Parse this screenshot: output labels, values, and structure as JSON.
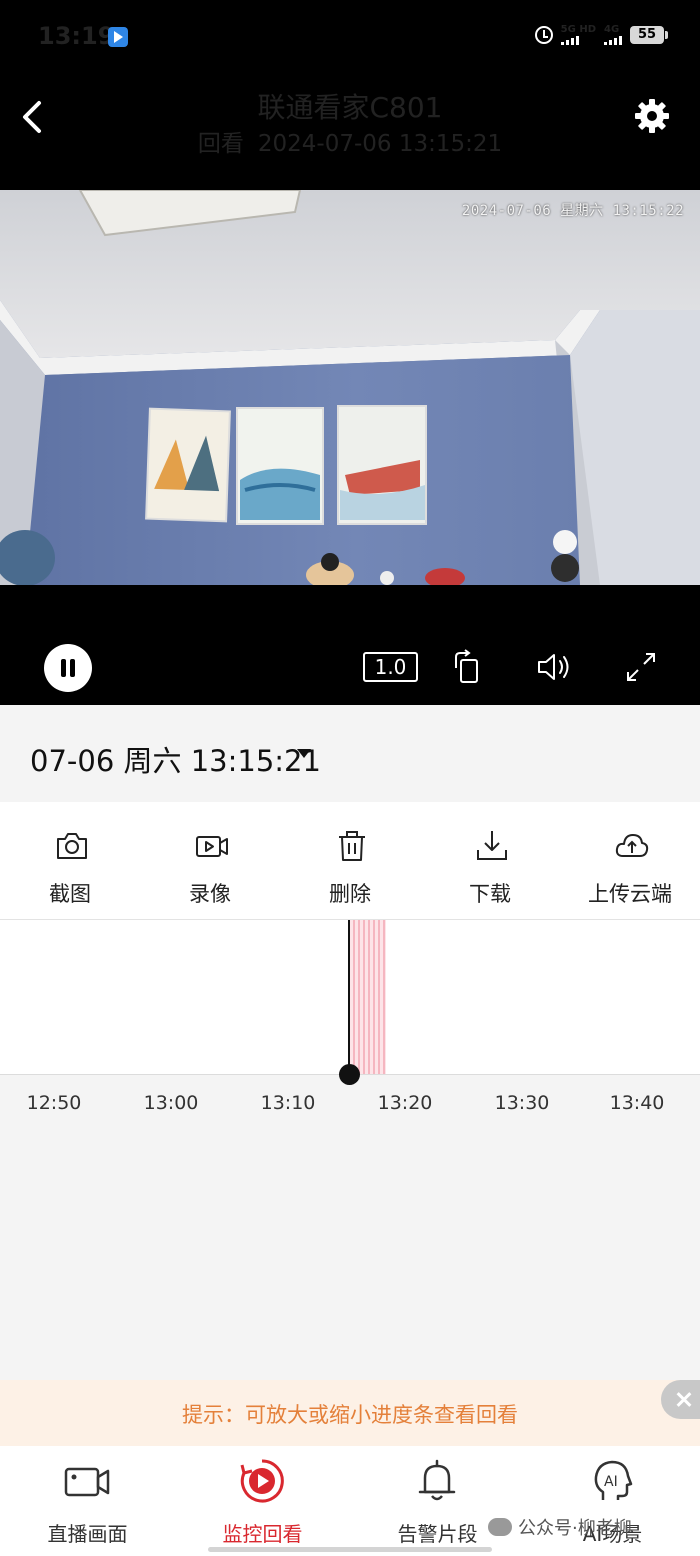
{
  "status_bar": {
    "time": "13:19",
    "network_1": "5G HD",
    "network_2": "4G",
    "battery": "55"
  },
  "header": {
    "title": "联通看家C801",
    "mode_label": "回看",
    "datetime": "2024-07-06 13:15:21"
  },
  "video": {
    "osd_timestamp": "2024-07-06 星期六 13:15:22"
  },
  "controls": {
    "speed": "1.0"
  },
  "date_picker": {
    "value": "07-06 周六 13:15:21"
  },
  "actions": [
    {
      "label": "截图",
      "icon": "camera-icon"
    },
    {
      "label": "录像",
      "icon": "video-record-icon"
    },
    {
      "label": "删除",
      "icon": "trash-icon"
    },
    {
      "label": "下载",
      "icon": "download-icon"
    },
    {
      "label": "上传云端",
      "icon": "cloud-upload-icon"
    }
  ],
  "timeline": {
    "ticks": [
      "12:50",
      "13:00",
      "13:10",
      "13:20",
      "13:30",
      "13:40"
    ],
    "current_time": "13:15:21"
  },
  "hint": {
    "text": "提示：可放大或缩小进度条查看回看"
  },
  "bottom_nav": [
    {
      "label": "直播画面",
      "icon": "live-camera-icon",
      "active": false
    },
    {
      "label": "监控回看",
      "icon": "playback-icon",
      "active": true
    },
    {
      "label": "告警片段",
      "icon": "bell-icon",
      "active": false
    },
    {
      "label": "AI场景",
      "icon": "ai-head-icon",
      "active": false
    }
  ],
  "watermark": "公众号·柳老柳",
  "colors": {
    "accent": "#d9282f",
    "hint_text": "#e4803a",
    "hint_bg": "#fdf1e6",
    "recording_strip": "#f5b6c0"
  }
}
